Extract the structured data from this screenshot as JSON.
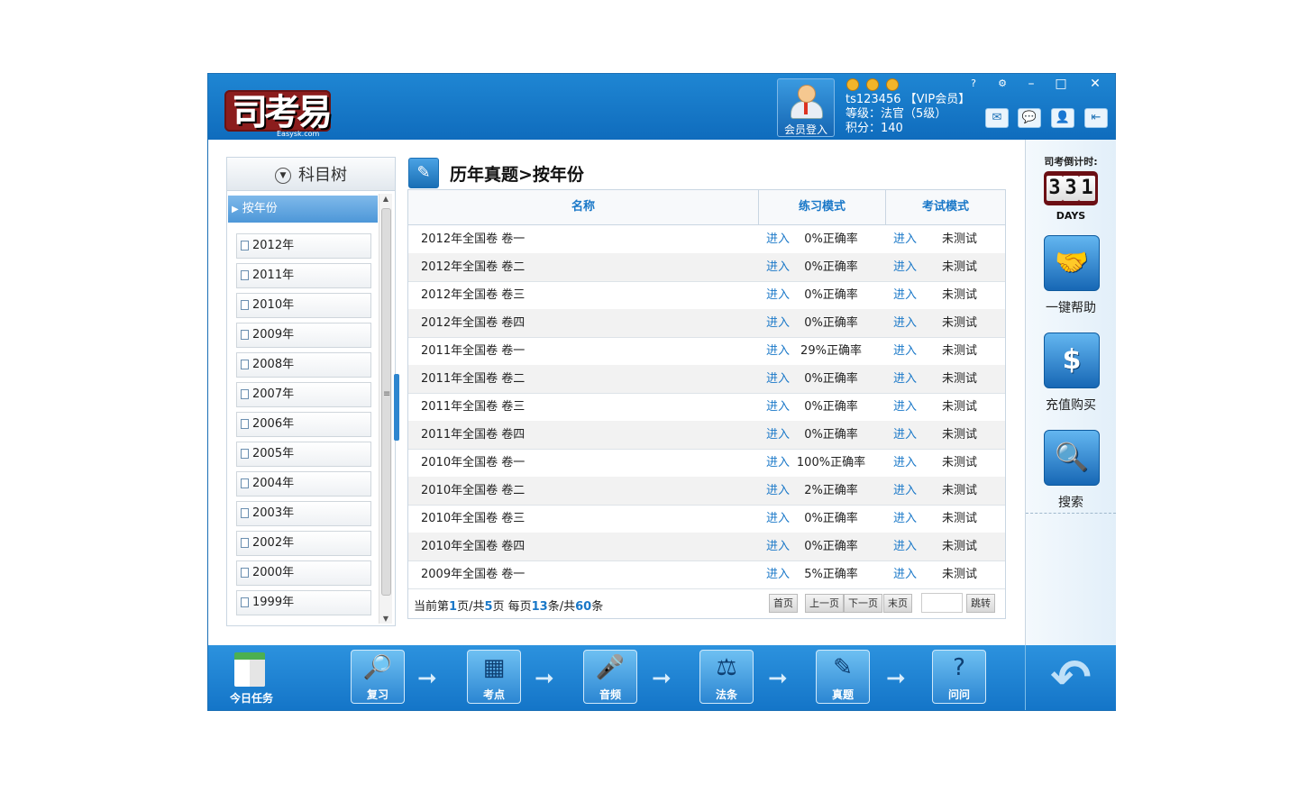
{
  "header": {
    "logo_text": "司考易",
    "logo_sub": "Easysk.com",
    "member_button": "会员登入",
    "username": "ts123456 【VIP会员】",
    "level": "等级：法官（5级）",
    "points": "积分：140",
    "window_controls": [
      "?",
      "⚙",
      "–",
      "□",
      "✕"
    ]
  },
  "tree": {
    "title": "科目树",
    "selected": "按年份",
    "years": [
      "2012年",
      "2011年",
      "2010年",
      "2009年",
      "2008年",
      "2007年",
      "2006年",
      "2005年",
      "2004年",
      "2003年",
      "2002年",
      "2000年",
      "1999年"
    ]
  },
  "main": {
    "title": "历年真题>按年份",
    "columns": [
      "名称",
      "练习模式",
      "考试模式"
    ],
    "enter_label": "进入",
    "rows": [
      {
        "name": "2012年全国卷 卷一",
        "rate": "0%正确率",
        "status": "未测试"
      },
      {
        "name": "2012年全国卷 卷二",
        "rate": "0%正确率",
        "status": "未测试"
      },
      {
        "name": "2012年全国卷 卷三",
        "rate": "0%正确率",
        "status": "未测试"
      },
      {
        "name": "2012年全国卷 卷四",
        "rate": "0%正确率",
        "status": "未测试"
      },
      {
        "name": "2011年全国卷 卷一",
        "rate": "29%正确率",
        "status": "未测试"
      },
      {
        "name": "2011年全国卷 卷二",
        "rate": "0%正确率",
        "status": "未测试"
      },
      {
        "name": "2011年全国卷 卷三",
        "rate": "0%正确率",
        "status": "未测试"
      },
      {
        "name": "2011年全国卷 卷四",
        "rate": "0%正确率",
        "status": "未测试"
      },
      {
        "name": "2010年全国卷 卷一",
        "rate": "100%正确率",
        "status": "未测试"
      },
      {
        "name": "2010年全国卷 卷二",
        "rate": "2%正确率",
        "status": "未测试"
      },
      {
        "name": "2010年全国卷 卷三",
        "rate": "0%正确率",
        "status": "未测试"
      },
      {
        "name": "2010年全国卷 卷四",
        "rate": "0%正确率",
        "status": "未测试"
      },
      {
        "name": "2009年全国卷 卷一",
        "rate": "5%正确率",
        "status": "未测试"
      }
    ],
    "pager": {
      "p1": "当前第",
      "current": "1",
      "p2": "页/共",
      "total_pages": "5",
      "p3": "页 每页",
      "per_page": "13",
      "p4": "条/共",
      "total": "60",
      "p5": "条",
      "first": "首页",
      "prev": "上一页",
      "next": "下一页",
      "last": "末页",
      "jump": "跳转"
    }
  },
  "right": {
    "countdown_label": "司考倒计时:",
    "digits": [
      "3",
      "3",
      "1"
    ],
    "days": "DAYS",
    "help": "一键帮助",
    "buy": "充值购买",
    "search": "搜索"
  },
  "footer": {
    "today": "今日任务",
    "steps": [
      "复习",
      "考点",
      "音频",
      "法条",
      "真题",
      "问问"
    ]
  },
  "colors": {
    "brand_blue": "#1a78c8",
    "header_blue": "#1f86d3",
    "logo_red": "#8b1d1d"
  }
}
